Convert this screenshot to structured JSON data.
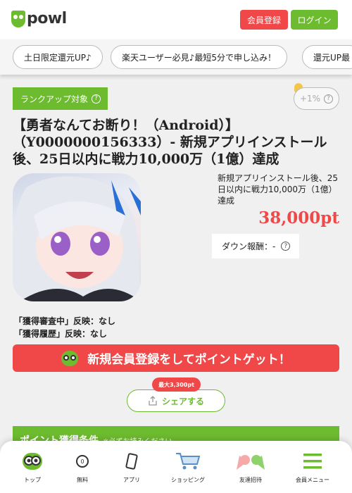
{
  "header": {
    "logo_text": "powl",
    "register_label": "会員登録",
    "login_label": "ログイン"
  },
  "chips": [
    {
      "label": "土日限定還元UP♪"
    },
    {
      "label": "楽天ユーザー必見♪最短5分で申し込み！"
    },
    {
      "label": "還元UP最"
    }
  ],
  "offer": {
    "rank_badge": "ランクアップ対象",
    "rate_badge": "+1%",
    "title": "【勇者なんてお断り！（Android）】（Y0000000156333）- 新規アプリインストール後、25日以内に戦力10,000万（1億）達成",
    "description": "新規アプリインストール後、25日以内に戦力10,000万（1億）達成",
    "points": "38,000pt",
    "down_reward": "ダウン報酬：-",
    "status_review": "「獲得審査中」反映：なし",
    "status_history": "「獲得履歴」反映：なし"
  },
  "cta": {
    "label": "新規会員登録をしてポイントゲット！"
  },
  "share": {
    "max_badge": "最大3,300pt",
    "label": "シェアする"
  },
  "conditions": {
    "title": "ポイント獲得条件",
    "note": "※必ずお読みください"
  },
  "bottom_nav": [
    {
      "label": "トップ"
    },
    {
      "label": "無料"
    },
    {
      "label": "アプリ"
    },
    {
      "label": "ショッピング"
    },
    {
      "label": "友達招待"
    },
    {
      "label": "会員メニュー"
    }
  ],
  "colors": {
    "accent_green": "#6dbb2f",
    "accent_red": "#f04848"
  }
}
